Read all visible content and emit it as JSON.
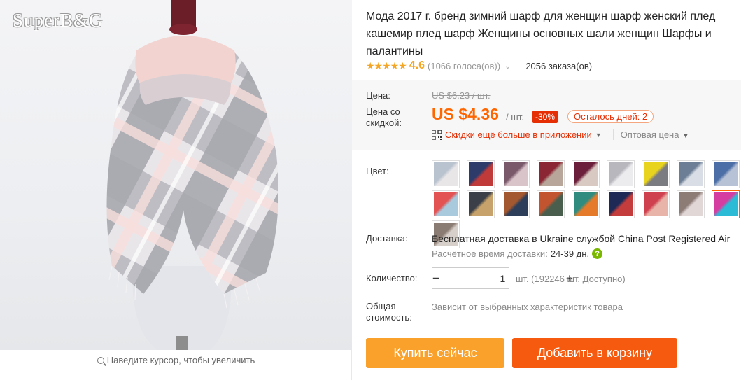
{
  "gallery": {
    "watermark": "SuperB&G",
    "zoom_hint": "Наведите курсор, чтобы увеличить"
  },
  "product": {
    "title": "Мода 2017 г. бренд зимний шарф для женщин шарф женский плед кашемир плед шарф Женщины основных шали женщин Шарфы и палантины",
    "rating": {
      "stars": 4.6,
      "stars_display": "★★★★★",
      "value": "4.6",
      "votes": "(1066 голоса(ов))",
      "orders": "2056 заказа(ов)"
    },
    "price": {
      "label_price": "Цена:",
      "old_price": "US $6.23 / шт.",
      "label_discount": "Цена со скидкой:",
      "new_price": "US $4.36",
      "per_unit": "/ шт.",
      "discount": "-30%",
      "days_left": "Осталось дней: 2",
      "app_discount": "Скидки ещё больше в приложении",
      "wholesale": "Оптовая цена"
    },
    "color": {
      "label": "Цвет:",
      "swatches": [
        {
          "name": "variant-1",
          "a": "#b9c3cf",
          "b": "#e9e6e8"
        },
        {
          "name": "variant-2",
          "a": "#2d3b6b",
          "b": "#c03a3a"
        },
        {
          "name": "variant-3",
          "a": "#7a5a6a",
          "b": "#d9c4c9"
        },
        {
          "name": "variant-4",
          "a": "#8b2635",
          "b": "#b9a69a"
        },
        {
          "name": "variant-5",
          "a": "#6b1f3a",
          "b": "#d8c9c2"
        },
        {
          "name": "variant-6",
          "a": "#b7b7bd",
          "b": "#ecebee"
        },
        {
          "name": "variant-7",
          "a": "#e8d31e",
          "b": "#7b7b82"
        },
        {
          "name": "variant-8",
          "a": "#6c7e96",
          "b": "#d9dde5"
        },
        {
          "name": "variant-9",
          "a": "#4b6fa6",
          "b": "#b8c2d6"
        },
        {
          "name": "variant-10",
          "a": "#e45353",
          "b": "#a9c9dc"
        },
        {
          "name": "variant-11",
          "a": "#3a3f48",
          "b": "#c7a26a"
        },
        {
          "name": "variant-12",
          "a": "#a3582f",
          "b": "#2c3e5a"
        },
        {
          "name": "variant-13",
          "a": "#c2552f",
          "b": "#4a5e4e"
        },
        {
          "name": "variant-14",
          "a": "#2f8c7e",
          "b": "#e57a2a"
        },
        {
          "name": "variant-15",
          "a": "#1e2a55",
          "b": "#c43c3c"
        },
        {
          "name": "variant-16",
          "a": "#d0414f",
          "b": "#e8b3a8"
        },
        {
          "name": "variant-17",
          "a": "#8d7b76",
          "b": "#e0d7d6"
        },
        {
          "name": "variant-18",
          "a": "#d63da0",
          "b": "#2bbbd6"
        },
        {
          "name": "variant-19",
          "a": "#8a7c72",
          "b": "#d7cfca"
        }
      ],
      "selected_index": 17
    },
    "shipping": {
      "label": "Доставка:",
      "main": "Бесплатная доставка в Ukraine службой China Post Registered Air",
      "eta_label": "Расчётное время доставки:",
      "eta_value": "24-39 дн.",
      "help": "?"
    },
    "quantity": {
      "label": "Количество:",
      "minus": "−",
      "plus": "+",
      "value": "1",
      "available": "шт. (192246 шт. Доступно)"
    },
    "total": {
      "label": "Общая стоимость:",
      "note": "Зависит от выбранных характеристик товара"
    },
    "actions": {
      "buy_now": "Купить сейчас",
      "add_to_cart": "Добавить в корзину"
    }
  },
  "colors": {
    "accent": "#ff6600",
    "discount_red": "#e62e04",
    "buy_button": "#f9a12b",
    "cart_button": "#f55a0f",
    "star": "#f5a623"
  }
}
